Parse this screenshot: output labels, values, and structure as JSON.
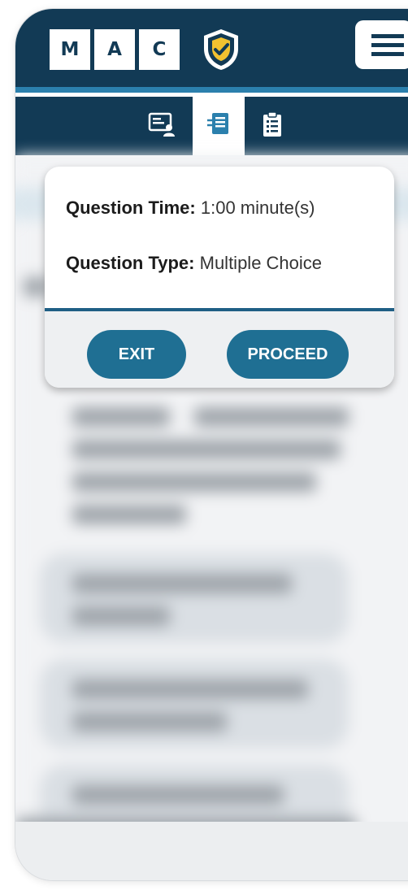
{
  "header": {
    "logo_letters": [
      "M",
      "A",
      "C"
    ],
    "logo_icon": "shield-check-icon",
    "menu_icon": "hamburger-menu-icon"
  },
  "tabs": [
    {
      "icon": "profile-card-icon",
      "active": false
    },
    {
      "icon": "document-list-icon",
      "active": true
    },
    {
      "icon": "clipboard-checklist-icon",
      "active": false
    }
  ],
  "modal": {
    "time_label": "Question Time:",
    "time_value": "1:00 minute(s)",
    "type_label": "Question Type:",
    "type_value": "Multiple Choice",
    "exit_label": "EXIT",
    "proceed_label": "PROCEED"
  },
  "colors": {
    "primary_dark": "#123a55",
    "accent_blue": "#2b80ad",
    "button_blue": "#1f6f93",
    "shield_gold": "#f2c230"
  }
}
